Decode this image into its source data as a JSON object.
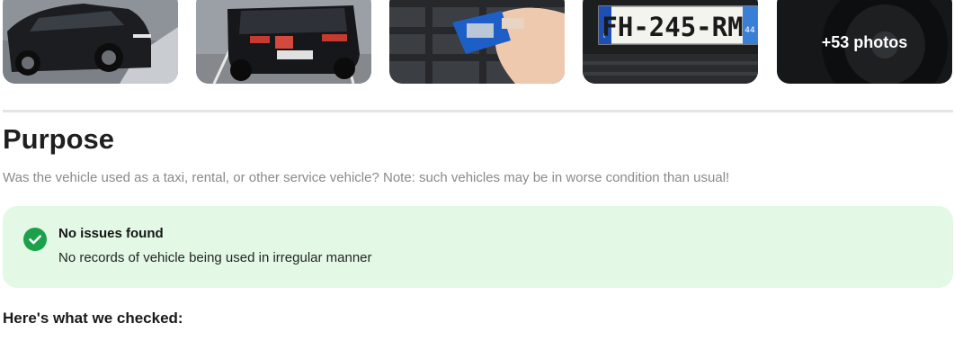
{
  "gallery": {
    "photos": [
      {
        "alt": "black-suv-front-photo"
      },
      {
        "alt": "black-suv-rear-photo"
      },
      {
        "alt": "tire-tread-gauge-photo"
      },
      {
        "alt": "license-plate-photo",
        "plate_text": "FH-245-RM",
        "plate_country": "F",
        "plate_region": "44"
      },
      {
        "alt": "wheel-photo"
      }
    ],
    "more_label": "+53 photos"
  },
  "purpose": {
    "title": "Purpose",
    "description": "Was the vehicle used as a taxi, rental, or other service vehicle? Note: such vehicles may be in worse condition than usual!"
  },
  "result": {
    "status_icon": "check-circle-icon",
    "title": "No issues found",
    "description": "No records of vehicle being used in irregular manner",
    "color_bg": "#e3f9e6",
    "color_icon": "#1aa14a"
  },
  "checked": {
    "heading": "Here's what we checked:"
  }
}
